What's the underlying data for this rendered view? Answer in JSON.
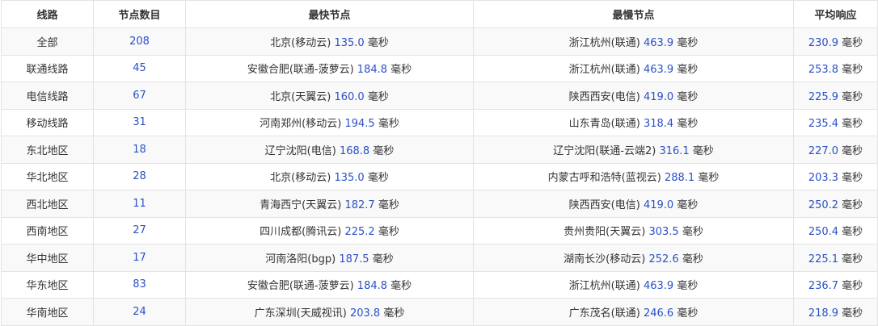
{
  "headers": [
    "线路",
    "节点数目",
    "最快节点",
    "最慢节点",
    "平均响应"
  ],
  "unit": "毫秒",
  "colors": {
    "number_blue": "#2b50c8",
    "text": "#333333",
    "stripe": "#f9f9f9",
    "border": "#e3e3e3"
  },
  "rows": [
    {
      "line": "全部",
      "count": "208",
      "fast_name": "北京(移动云)",
      "fast_ms": "135.0",
      "slow_name": "浙江杭州(联通)",
      "slow_ms": "463.9",
      "avg_ms": "230.9"
    },
    {
      "line": "联通线路",
      "count": "45",
      "fast_name": "安徽合肥(联通-菠萝云)",
      "fast_ms": "184.8",
      "slow_name": "浙江杭州(联通)",
      "slow_ms": "463.9",
      "avg_ms": "253.8"
    },
    {
      "line": "电信线路",
      "count": "67",
      "fast_name": "北京(天翼云)",
      "fast_ms": "160.0",
      "slow_name": "陕西西安(电信)",
      "slow_ms": "419.0",
      "avg_ms": "225.9"
    },
    {
      "line": "移动线路",
      "count": "31",
      "fast_name": "河南郑州(移动云)",
      "fast_ms": "194.5",
      "slow_name": "山东青岛(联通)",
      "slow_ms": "318.4",
      "avg_ms": "235.4"
    },
    {
      "line": "东北地区",
      "count": "18",
      "fast_name": "辽宁沈阳(电信)",
      "fast_ms": "168.8",
      "slow_name": "辽宁沈阳(联通-云端2)",
      "slow_ms": "316.1",
      "avg_ms": "227.0"
    },
    {
      "line": "华北地区",
      "count": "28",
      "fast_name": "北京(移动云)",
      "fast_ms": "135.0",
      "slow_name": "内蒙古呼和浩特(蓝视云)",
      "slow_ms": "288.1",
      "avg_ms": "203.3"
    },
    {
      "line": "西北地区",
      "count": "11",
      "fast_name": "青海西宁(天翼云)",
      "fast_ms": "182.7",
      "slow_name": "陕西西安(电信)",
      "slow_ms": "419.0",
      "avg_ms": "250.2"
    },
    {
      "line": "西南地区",
      "count": "27",
      "fast_name": "四川成都(腾讯云)",
      "fast_ms": "225.2",
      "slow_name": "贵州贵阳(天翼云)",
      "slow_ms": "303.5",
      "avg_ms": "250.4"
    },
    {
      "line": "华中地区",
      "count": "17",
      "fast_name": "河南洛阳(bgp)",
      "fast_ms": "187.5",
      "slow_name": "湖南长沙(移动云)",
      "slow_ms": "252.6",
      "avg_ms": "225.1"
    },
    {
      "line": "华东地区",
      "count": "83",
      "fast_name": "安徽合肥(联通-菠萝云)",
      "fast_ms": "184.8",
      "slow_name": "浙江杭州(联通)",
      "slow_ms": "463.9",
      "avg_ms": "236.7"
    },
    {
      "line": "华南地区",
      "count": "24",
      "fast_name": "广东深圳(天威视讯)",
      "fast_ms": "203.8",
      "slow_name": "广东茂名(联通)",
      "slow_ms": "246.6",
      "avg_ms": "218.9"
    }
  ]
}
